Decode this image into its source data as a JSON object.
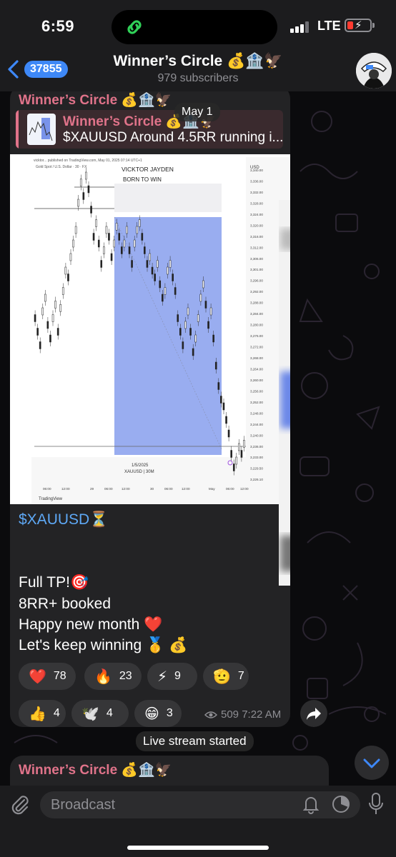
{
  "status_bar": {
    "time": "6:59",
    "network": "LTE"
  },
  "header": {
    "back_count": "37855",
    "title": "Winner’s Circle 💰🏦🦅",
    "subtitle": "979 subscribers"
  },
  "message": {
    "sender": "Winner’s Circle 💰🏦🦅",
    "reply": {
      "title": "Winner’s Circle 💰🏦🦅",
      "text": "$XAUUSD Around 4.5RR running i..."
    },
    "date_chip": "May 1",
    "chart": {
      "header_line": "vicktor... published on TradingView.com, May 01, 2025 07:14 UTC+1",
      "symbol_line": "Gold Spot / U.S. Dollar · 30 · FX",
      "watermark_line1": "VICKTOR JAYDEN",
      "watermark_line2": "BORN TO WIN",
      "axis_currency": "USD",
      "price_labels": [
        "3,340.00",
        "3,336.00",
        "3,332.00",
        "3,328.00",
        "3,324.00",
        "3,320.00",
        "3,316.00",
        "3,312.00",
        "3,306.00",
        "3,301.00",
        "3,296.00",
        "3,292.00",
        "3,288.00",
        "3,284.00",
        "3,280.00",
        "3,276.00",
        "3,272.00",
        "3,268.00",
        "3,264.00",
        "3,260.00",
        "3,256.00",
        "3,252.00",
        "3,248.00",
        "3,244.00",
        "3,240.00",
        "3,236.00",
        "3,233.00",
        "3,229.50",
        "3,226.10"
      ],
      "time_labels": [
        "06:00",
        "12:00",
        "29",
        "06:00",
        "12:00",
        "30",
        "06:00",
        "12:00",
        "May",
        "06:00",
        "12:00"
      ],
      "footer_date": "1/5/2025",
      "footer_symbol": "XAUUSD | 30M",
      "brand": "TradingView"
    },
    "ticker": "$XAUUSD⏳",
    "lines": [
      "Full TP!🎯",
      "8RR+ booked",
      "Happy new month ❤️",
      "Let's keep winning 🥇 💰"
    ],
    "reactions": [
      {
        "emoji": "❤️",
        "count": "78"
      },
      {
        "emoji": "🔥",
        "count": "23"
      },
      {
        "emoji": "⚡",
        "count": "9"
      },
      {
        "emoji": "🫡",
        "count": "7"
      },
      {
        "emoji": "👍",
        "count": "4"
      },
      {
        "emoji": "🕊️",
        "count": "4"
      },
      {
        "emoji": "😁",
        "count": "3"
      }
    ],
    "views": "509",
    "time": "7:22 AM"
  },
  "service_message": "Live stream started",
  "next_message": {
    "sender": "Winner’s Circle 💰🏦🦅"
  },
  "composer": {
    "placeholder": "Broadcast"
  },
  "colors": {
    "accent": "#3e88f7",
    "sender": "#e0738a",
    "ticker": "#5ea8f5",
    "chart_box": "#5b7be6"
  }
}
